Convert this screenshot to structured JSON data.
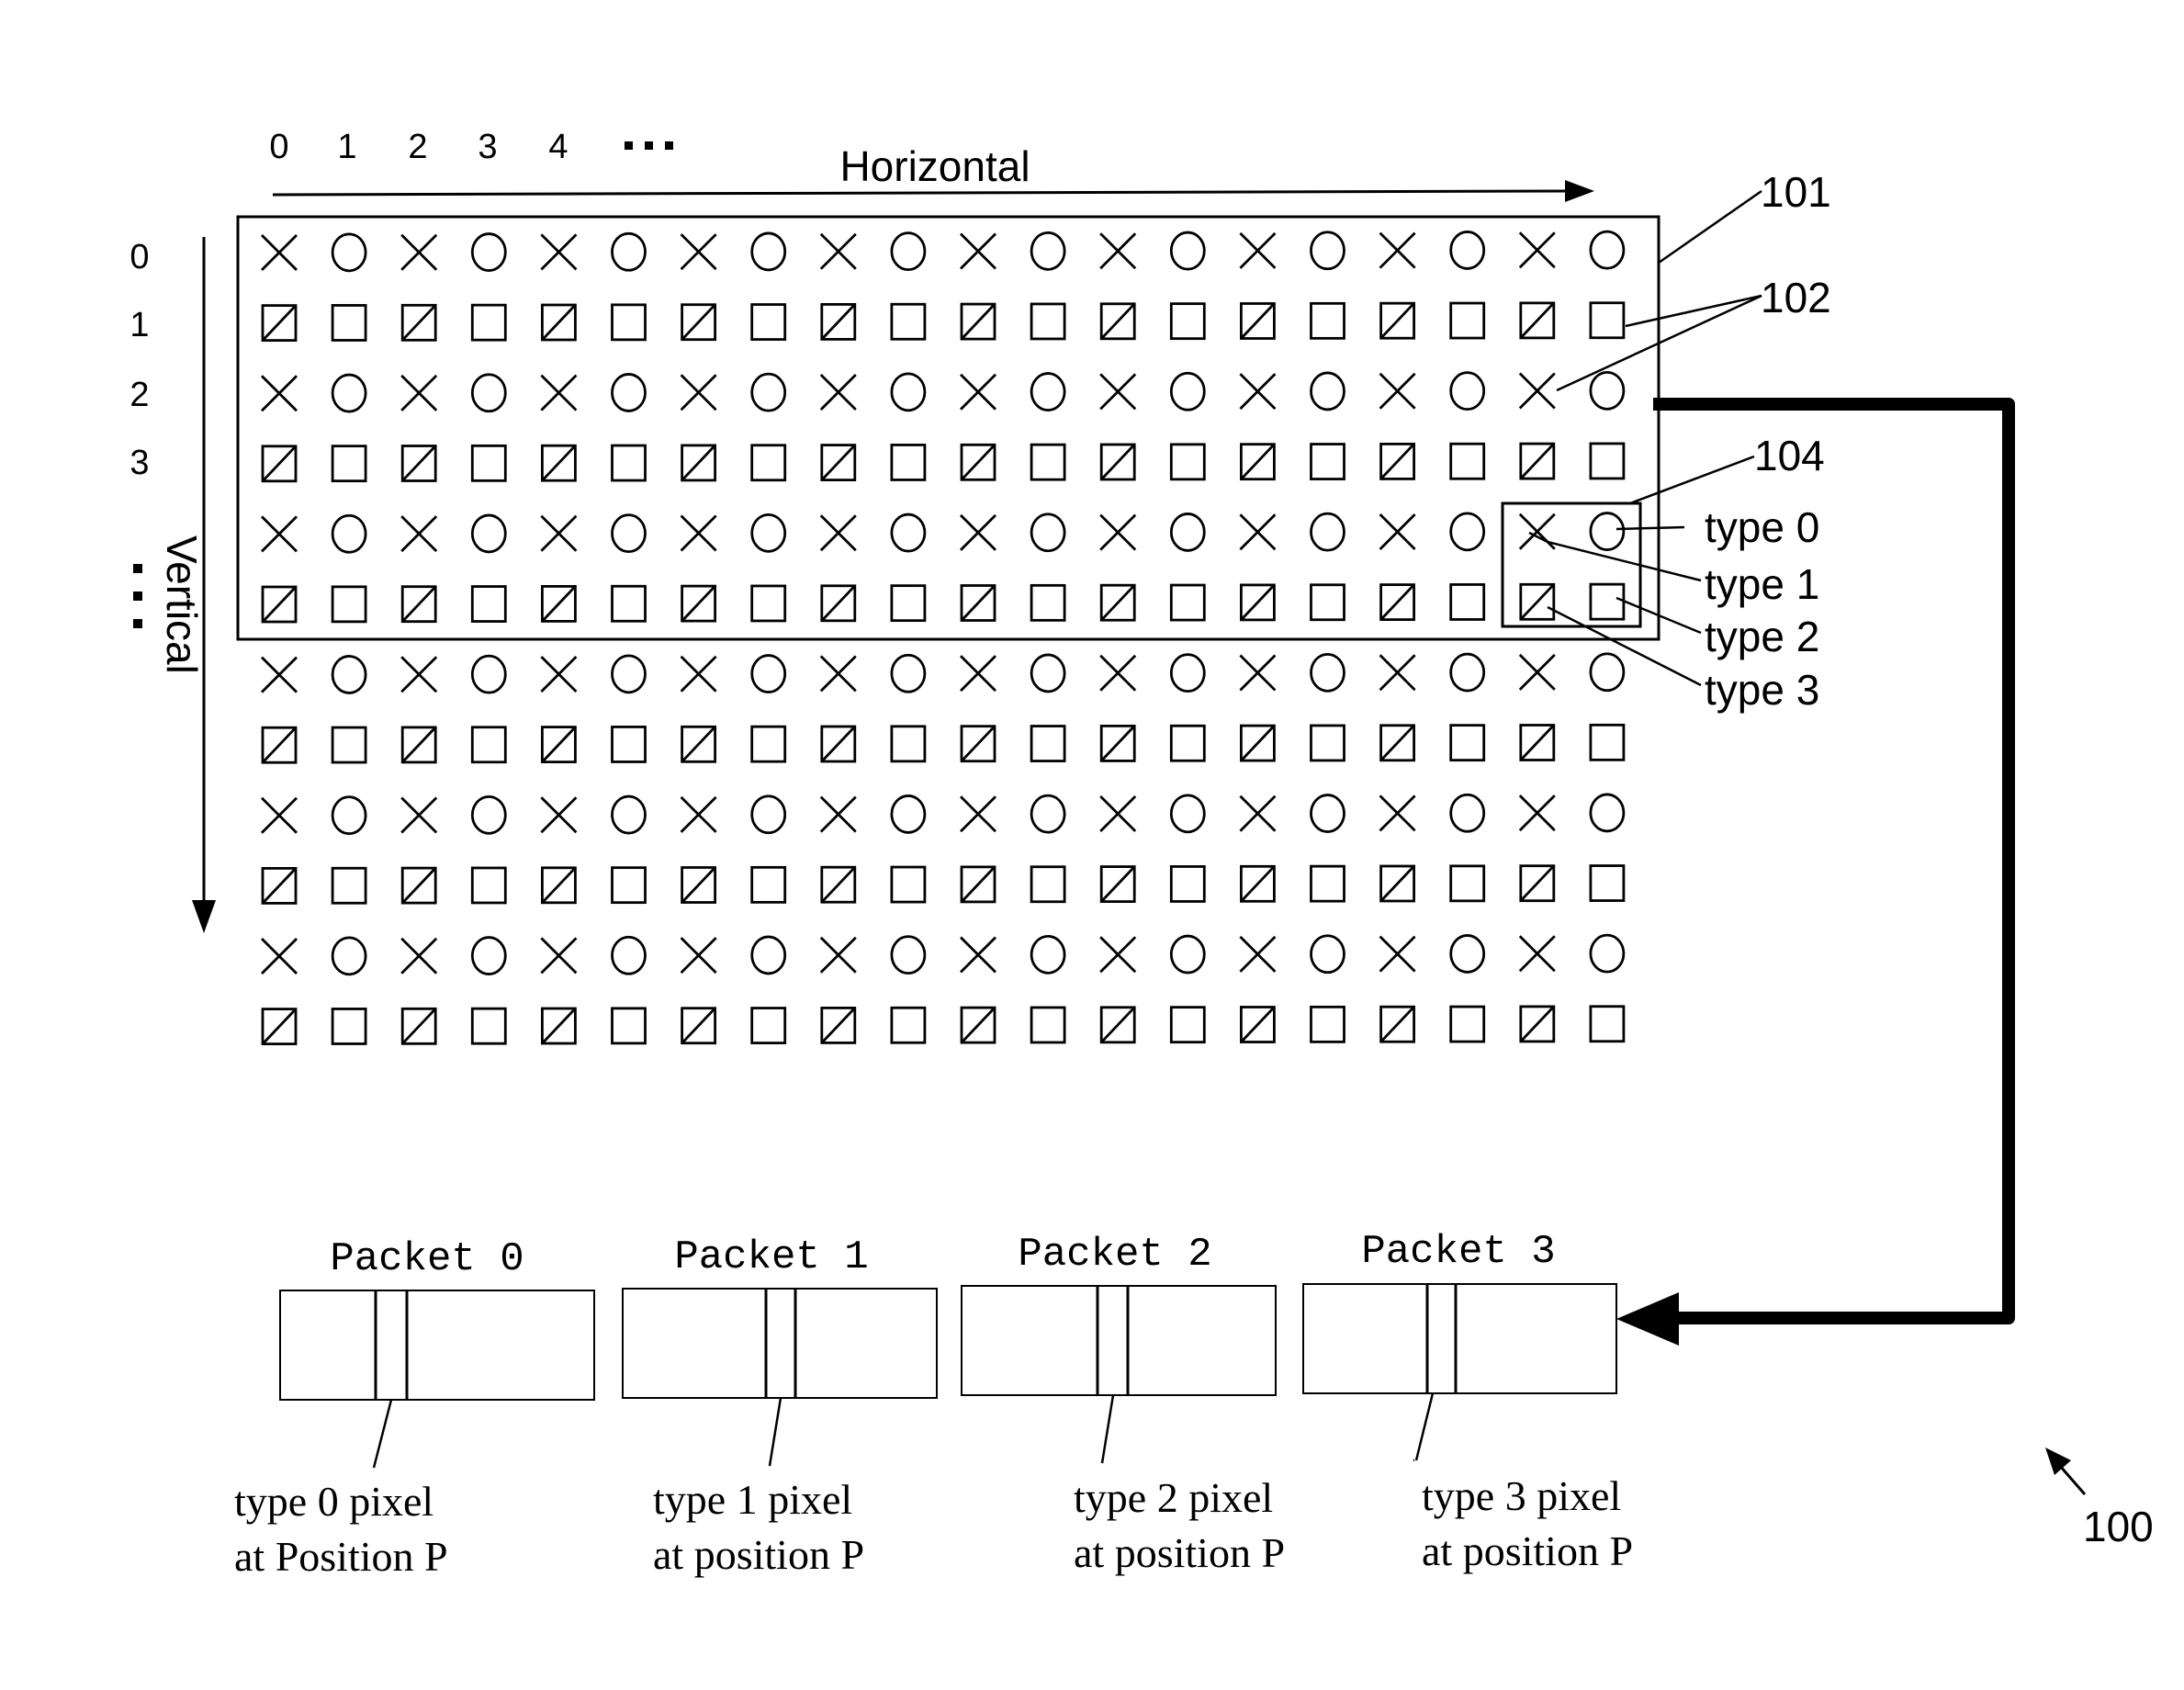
{
  "figure_number": "100",
  "axes": {
    "horizontal_label": "Horizontal",
    "vertical_label": "Vertical",
    "column_labels": [
      "0",
      "1",
      "2",
      "3",
      "4"
    ],
    "column_ellipsis": "▪▪▪",
    "row_labels": [
      "0",
      "1",
      "2",
      "3"
    ],
    "row_ellipsis": "▪"
  },
  "grid": {
    "rows": 12,
    "cols": 20,
    "pattern": [
      [
        "x",
        "o"
      ],
      [
        "slash-square",
        "square"
      ]
    ],
    "region_box_label": "101",
    "pixel_label": "102",
    "group_box_label": "104"
  },
  "legend": {
    "types": [
      "type 0",
      "type 1",
      "type 2",
      "type 3"
    ]
  },
  "packets": [
    {
      "title": "Packet 0",
      "caption_line1": "type 0 pixel",
      "caption_line2": "at Position P"
    },
    {
      "title": "Packet 1",
      "caption_line1": "type 1 pixel",
      "caption_line2": "at position P"
    },
    {
      "title": "Packet 2",
      "caption_line1": "type 2 pixel",
      "caption_line2": "at position P"
    },
    {
      "title": "Packet 3",
      "caption_line1": "type 3 pixel",
      "caption_line2": "at position P"
    }
  ],
  "colors": {
    "ink": "#000000",
    "paper": "#ffffff"
  }
}
